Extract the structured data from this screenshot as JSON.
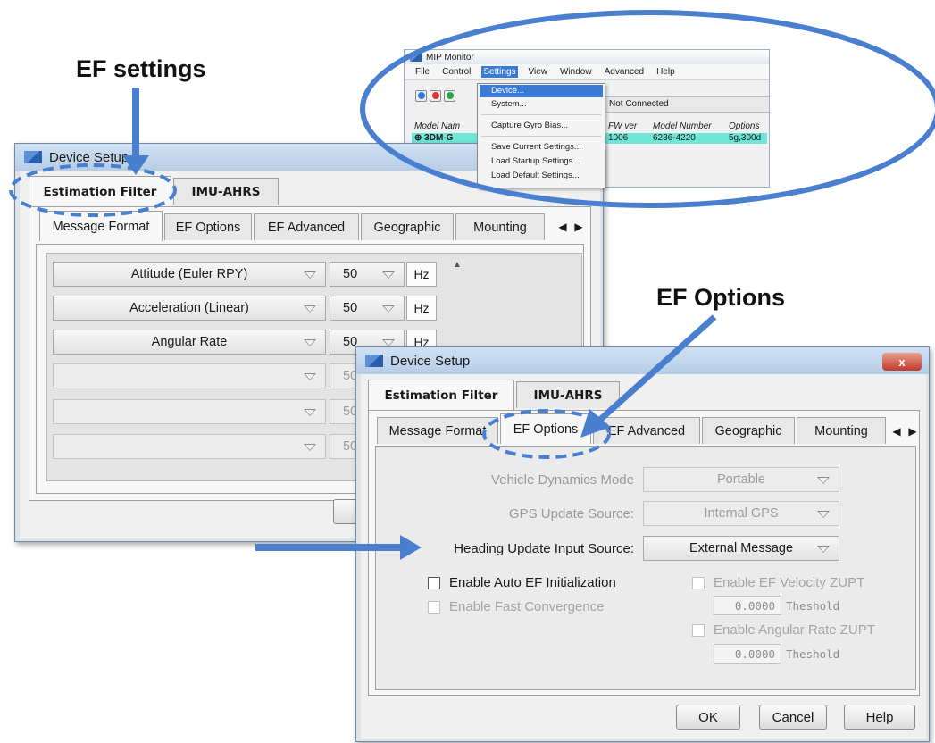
{
  "annotations": {
    "ef_settings": "EF settings",
    "ef_options": "EF Options"
  },
  "colors": {
    "annotation_blue": "#4a7fd0",
    "menu_highlight": "#3a7bd5",
    "row_highlight": "#6ee6d8"
  },
  "monitor": {
    "title": "MIP Monitor",
    "menubar": [
      "File",
      "Control",
      "Settings",
      "View",
      "Window",
      "Advanced",
      "Help"
    ],
    "active_menu": "Settings",
    "status": "Not Connected",
    "columns": [
      "Model Nam",
      "FW ver",
      "Model Number",
      "Options"
    ],
    "row": [
      "3DM-G",
      "1006",
      "6236-4220",
      "5g,300d"
    ],
    "settings_menu": [
      "Device...",
      "System...",
      "Capture Gyro Bias...",
      "Save Current Settings...",
      "Load Startup Settings...",
      "Load Default Settings..."
    ],
    "selected_item": "Device..."
  },
  "dialog_back": {
    "title": "Device Setup",
    "top_tabs": [
      "Estimation Filter",
      "IMU-AHRS"
    ],
    "sub_tabs": [
      "Message Format",
      "EF Options",
      "EF Advanced",
      "Geographic",
      "Mounting"
    ],
    "rows": [
      {
        "field": "Attitude (Euler RPY)",
        "rate": "50",
        "unit": "Hz",
        "enabled": true
      },
      {
        "field": "Acceleration (Linear)",
        "rate": "50",
        "unit": "Hz",
        "enabled": true
      },
      {
        "field": "Angular Rate",
        "rate": "50",
        "unit": "Hz",
        "enabled": true
      },
      {
        "field": "",
        "rate": "50",
        "unit": "",
        "enabled": false
      },
      {
        "field": "",
        "rate": "50",
        "unit": "",
        "enabled": false
      },
      {
        "field": "",
        "rate": "50",
        "unit": "",
        "enabled": false
      }
    ]
  },
  "dialog_front": {
    "title": "Device Setup",
    "close": "x",
    "top_tabs": [
      "Estimation Filter",
      "IMU-AHRS"
    ],
    "sub_tabs": [
      "Message Format",
      "EF Options",
      "EF Advanced",
      "Geographic",
      "Mounting"
    ],
    "vehicle_dynamics_label": "Vehicle Dynamics Mode",
    "vehicle_dynamics_value": "Portable",
    "gps_update_label": "GPS Update Source:",
    "gps_update_value": "Internal GPS",
    "heading_update_label": "Heading Update Input Source:",
    "heading_update_value": "External Message",
    "auto_ef_init": "Enable Auto EF Initialization",
    "fast_convergence": "Enable Fast Convergence",
    "velocity_zupt": "Enable EF Velocity ZUPT",
    "velocity_threshold": "0.0000",
    "angular_zupt": "Enable Angular Rate ZUPT",
    "angular_threshold": "0.0000",
    "threshold_label": "Theshold",
    "ok": "OK",
    "cancel": "Cancel",
    "help": "Help"
  }
}
